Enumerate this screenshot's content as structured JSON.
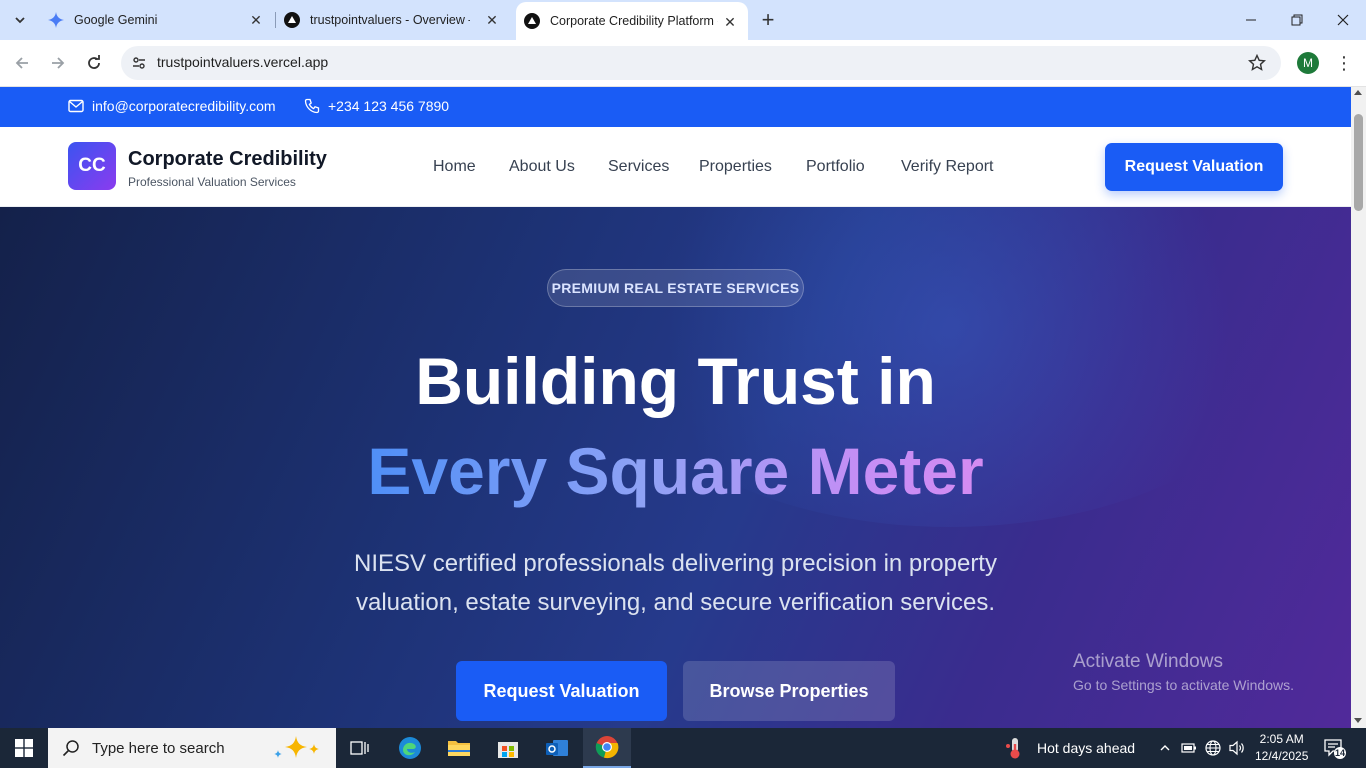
{
  "browser": {
    "tabs": [
      {
        "title": "Google Gemini",
        "favicon": "gemini-icon",
        "active": false
      },
      {
        "title": "trustpointvaluers - Overview – V",
        "favicon": "vercel-icon",
        "active": false
      },
      {
        "title": "Corporate Credibility Platform -",
        "favicon": "vercel-icon",
        "active": true
      }
    ],
    "url": "trustpointvaluers.vercel.app",
    "profile_initial": "M"
  },
  "contact": {
    "email": "info@corporatecredibility.com",
    "phone": "+234 123 456 7890"
  },
  "brand": {
    "logo_text": "CC",
    "name": "Corporate Credibility",
    "tagline": "Professional Valuation Services",
    "accent_color": "#1a5cf5"
  },
  "nav": {
    "items": [
      "Home",
      "About Us",
      "Services",
      "Properties",
      "Portfolio",
      "Verify Report"
    ],
    "cta": "Request Valuation"
  },
  "hero": {
    "badge": "PREMIUM REAL ESTATE SERVICES",
    "title_line1": "Building Trust in",
    "title_line2": "Every Square Meter",
    "subtitle": "NIESV certified professionals delivering precision in property valuation, estate surveying, and secure verification services.",
    "primary_button": "Request Valuation",
    "secondary_button": "Browse Properties"
  },
  "watermark": {
    "line1": "Activate Windows",
    "line2": "Go to Settings to activate Windows."
  },
  "taskbar": {
    "search_placeholder": "Type here to search",
    "weather": "Hot days ahead",
    "time": "2:05 AM",
    "date": "12/4/2025",
    "notification_count": "14"
  }
}
